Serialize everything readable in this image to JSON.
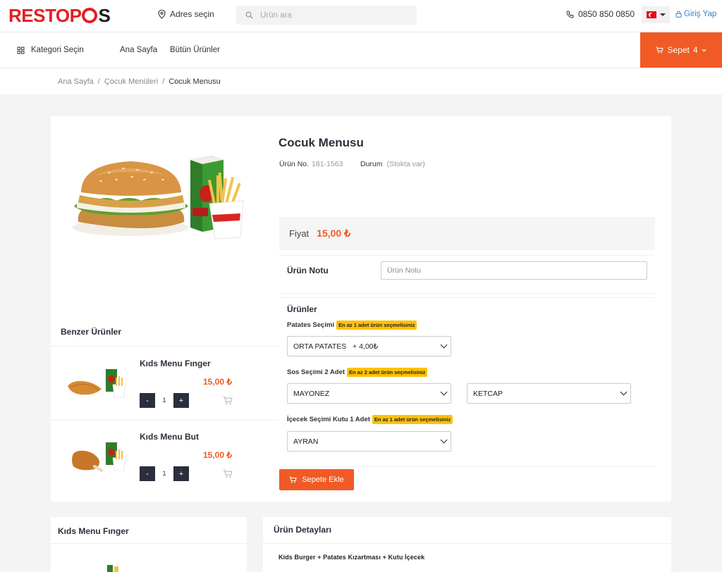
{
  "header": {
    "logo_text_left": "RESTOP",
    "logo_text_right": "S",
    "address_label": "Adres seçin",
    "search_placeholder": "Ürün ara",
    "phone": "0850 850 0850",
    "login_label": "Giriş Yap"
  },
  "nav": {
    "category_label": "Kategori Seçin",
    "links": [
      "Ana Sayfa",
      "Bütün Ürünler"
    ],
    "cart_label": "Sepet",
    "cart_count": "4"
  },
  "breadcrumb": {
    "items": [
      "Ana Sayfa",
      "Çocuk Menüleri",
      "Cocuk Menusu"
    ],
    "separator": "/"
  },
  "product": {
    "title": "Cocuk Menusu",
    "sku_label": "Ürün No.",
    "sku_value": "181-1563",
    "status_label": "Durum",
    "status_value": "(Stokta var)",
    "price_label": "Fiyat",
    "price_value": "15,00 ₺",
    "note_label": "Ürün Notu",
    "note_placeholder": "Ürün Notu",
    "options_title": "Ürünler",
    "groups": [
      {
        "label": "Patates Seçimi",
        "badge": "En az 1 adet ürün seçmelisiniz",
        "selects": [
          "ORTA PATATES   + 4,00₺"
        ]
      },
      {
        "label": "Sos Seçimi 2 Adet",
        "badge": "En az 2 adet ürün seçmelisiniz",
        "selects": [
          "MAYONEZ",
          "KETCAP"
        ]
      },
      {
        "label": "İçecek Seçimi Kutu 1 Adet",
        "badge": "En az 1 adet ürün seçmelisiniz",
        "selects": [
          "AYRAN"
        ]
      }
    ],
    "add_to_cart_label": "Sepete Ekle"
  },
  "similar": {
    "title": "Benzer Ürünler",
    "items": [
      {
        "name": "Kıds Menu Fınger",
        "price": "15,00 ₺",
        "qty": "1",
        "minus": "-",
        "plus": "+"
      },
      {
        "name": "Kıds Menu But",
        "price": "15,00 ₺",
        "qty": "1",
        "minus": "-",
        "plus": "+"
      }
    ]
  },
  "bottom": {
    "left_title": "Kıds Menu Fınger",
    "details_title": "Ürün Detayları",
    "details_text": "Kids Burger + Patates Kızartması + Kutu İçecek"
  },
  "colors": {
    "accent": "#f15a24",
    "brand_red": "#e31e24",
    "dark_button": "#2a2e3d",
    "badge": "#ffc107"
  }
}
